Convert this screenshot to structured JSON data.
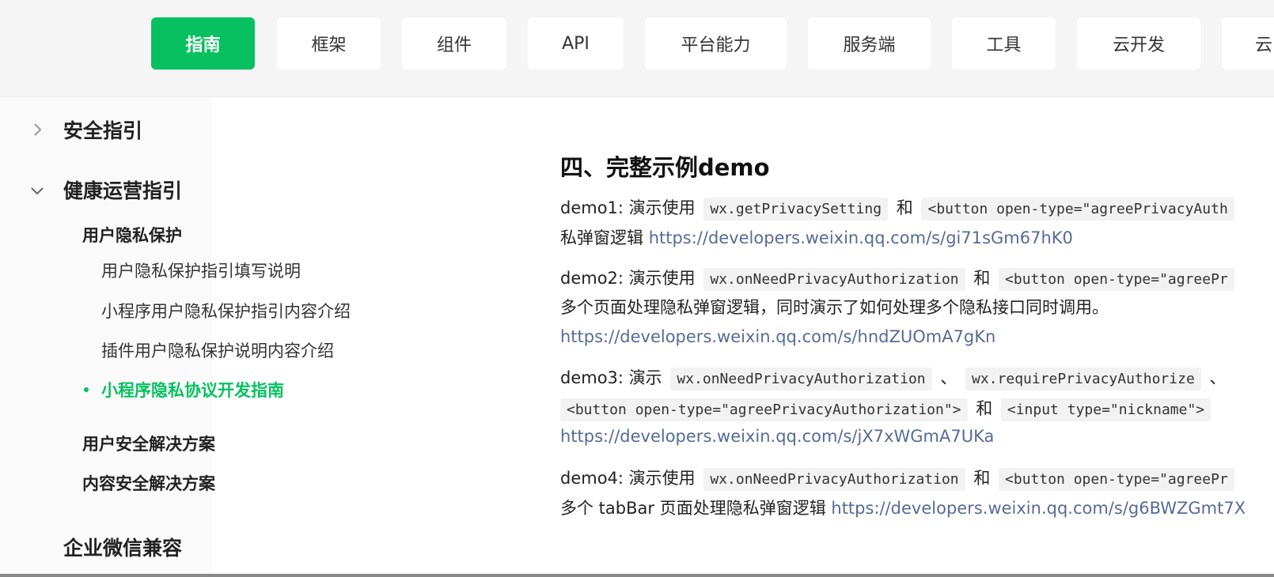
{
  "nav": {
    "items": [
      "指南",
      "框架",
      "组件",
      "API",
      "平台能力",
      "服务端",
      "工具",
      "云开发",
      "云"
    ],
    "active_index": 0
  },
  "sidebar": {
    "group_security": "安全指引",
    "group_health": "健康运营指引",
    "sub_privacy": "用户隐私保护",
    "items": [
      "用户隐私保护指引填写说明",
      "小程序用户隐私保护指引内容介绍",
      "插件用户隐私保护说明内容介绍",
      "小程序隐私协议开发指南"
    ],
    "active_item_index": 3,
    "sub_user_security": "用户安全解决方案",
    "sub_content_security": "内容安全解决方案",
    "group_wecom": "企业微信兼容"
  },
  "content": {
    "heading": "四、完整示例demo",
    "demo1": {
      "prefix": "demo1: 演示使用",
      "code1": "wx.getPrivacySetting",
      "and": "和",
      "code2": "<button open-type=\"agreePrivacyAuth",
      "line2_text": "私弹窗逻辑",
      "link": "https://developers.weixin.qq.com/s/gi71sGm67hK0"
    },
    "demo2": {
      "prefix": "demo2: 演示使用",
      "code1": "wx.onNeedPrivacyAuthorization",
      "and": "和",
      "code2": "<button open-type=\"agreePr",
      "line2_text": "多个页面处理隐私弹窗逻辑，同时演示了如何处理多个隐私接口同时调用。",
      "link": "https://developers.weixin.qq.com/s/hndZUOmA7gKn"
    },
    "demo3": {
      "prefix": "demo3: 演示",
      "code1": "wx.onNeedPrivacyAuthorization",
      "sep1": "、",
      "code2": "wx.requirePrivacyAuthorize",
      "sep2": "、",
      "code3": "<button open-type=\"agreePrivacyAuthorization\">",
      "and": "和",
      "code4": "<input type=\"nickname\">",
      "link": "https://developers.weixin.qq.com/s/jX7xWGmA7UKa"
    },
    "demo4": {
      "prefix": "demo4: 演示使用",
      "code1": "wx.onNeedPrivacyAuthorization",
      "and": "和",
      "code2": "<button open-type=\"agreePr",
      "line2_text": "多个 tabBar 页面处理隐私弹窗逻辑",
      "link": "https://developers.weixin.qq.com/s/g6BWZGmt7X"
    }
  },
  "colors": {
    "accent": "#07c160",
    "link": "#576b95",
    "code_bg": "#f2f2f2"
  }
}
